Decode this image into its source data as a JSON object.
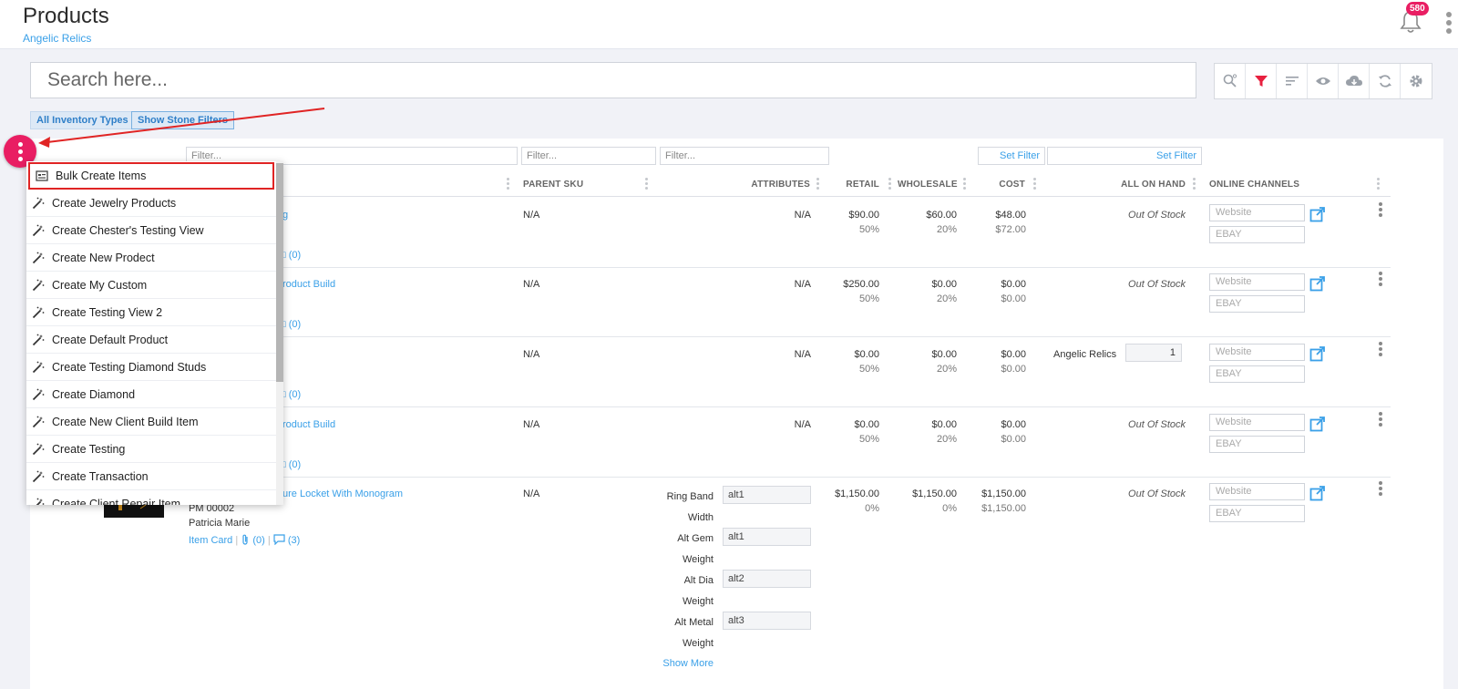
{
  "header": {
    "title": "Products",
    "subtitle": "Angelic Relics",
    "notification_count": "580"
  },
  "search": {
    "placeholder": "Search here..."
  },
  "chips": {
    "inventory_types": "All Inventory Types",
    "stone_filters": "Show Stone Filters"
  },
  "filters": {
    "placeholder": "Filter...",
    "set_filter": "Set Filter"
  },
  "columns": {
    "parent_sku": "PARENT SKU",
    "attributes": "ATTRIBUTES",
    "retail": "RETAIL",
    "wholesale": "WHOLESALE",
    "cost": "COST",
    "all_on_hand": "ALL ON HAND",
    "online_channels": "ONLINE CHANNELS"
  },
  "channels": {
    "website": "Website",
    "ebay": "EBAY"
  },
  "rows": [
    {
      "name_partial": "",
      "parent_sku": "N/A",
      "attributes": "N/A",
      "retail": "$90.00",
      "retail_pct": "50%",
      "wholesale": "$60.00",
      "wholesale_pct": "20%",
      "cost": "$48.00",
      "cost2": "$72.00",
      "on_hand": "Out Of Stock",
      "comments": "(0)"
    },
    {
      "name_partial": "roduct Build",
      "parent_sku": "N/A",
      "attributes": "N/A",
      "retail": "$250.00",
      "retail_pct": "50%",
      "wholesale": "$0.00",
      "wholesale_pct": "20%",
      "cost": "$0.00",
      "cost2": "$0.00",
      "on_hand": "Out Of Stock",
      "comments": "(0)"
    },
    {
      "name_partial": "",
      "parent_sku": "N/A",
      "attributes": "N/A",
      "retail": "$0.00",
      "retail_pct": "50%",
      "wholesale": "$0.00",
      "wholesale_pct": "20%",
      "cost": "$0.00",
      "cost2": "$0.00",
      "on_hand_location": "Angelic Relics",
      "on_hand_qty": "1",
      "comments": "(0)"
    },
    {
      "name_partial": "roduct Build",
      "parent_sku": "N/A",
      "attributes": "N/A",
      "retail": "$0.00",
      "retail_pct": "50%",
      "wholesale": "$0.00",
      "wholesale_pct": "20%",
      "cost": "$0.00",
      "cost2": "$0.00",
      "on_hand": "Out Of Stock",
      "comments": "(0)"
    },
    {
      "name_partial": "ure Locket With Monogram",
      "sku_partial": "PM 00002",
      "owner": "Patricia Marie",
      "item_card": "Item Card",
      "attachments": "(0)",
      "comments": "(3)",
      "parent_sku": "N/A",
      "attr_list": [
        {
          "label": "Ring Band",
          "value": "alt1"
        },
        {
          "label": "Width",
          "value": ""
        },
        {
          "label": "Alt Gem",
          "value": "alt1"
        },
        {
          "label": "Weight",
          "value": ""
        },
        {
          "label": "Alt Dia",
          "value": "alt2"
        },
        {
          "label": "Weight",
          "value": ""
        },
        {
          "label": "Alt Metal",
          "value": "alt3"
        },
        {
          "label": "Weight",
          "value": ""
        }
      ],
      "show_more": "Show More",
      "retail": "$1,150.00",
      "retail_pct": "0%",
      "wholesale": "$1,150.00",
      "wholesale_pct": "0%",
      "cost": "$1,150.00",
      "cost2": "$1,150.00",
      "on_hand": "Out Of Stock"
    }
  ],
  "menu": {
    "items": [
      "Bulk Create Items",
      "Create Jewelry Products",
      "Create Chester's Testing View",
      "Create New Prodect",
      "Create My Custom",
      "Create Testing View 2",
      "Create Default Product",
      "Create Testing Diamond Studs",
      "Create Diamond",
      "Create New Client Build Item",
      "Create Testing",
      "Create Transaction",
      "Create Client Repair Item"
    ]
  },
  "colors": {
    "accent": "#e91e63",
    "link": "#3aa0e8",
    "highlight": "#e02424"
  }
}
